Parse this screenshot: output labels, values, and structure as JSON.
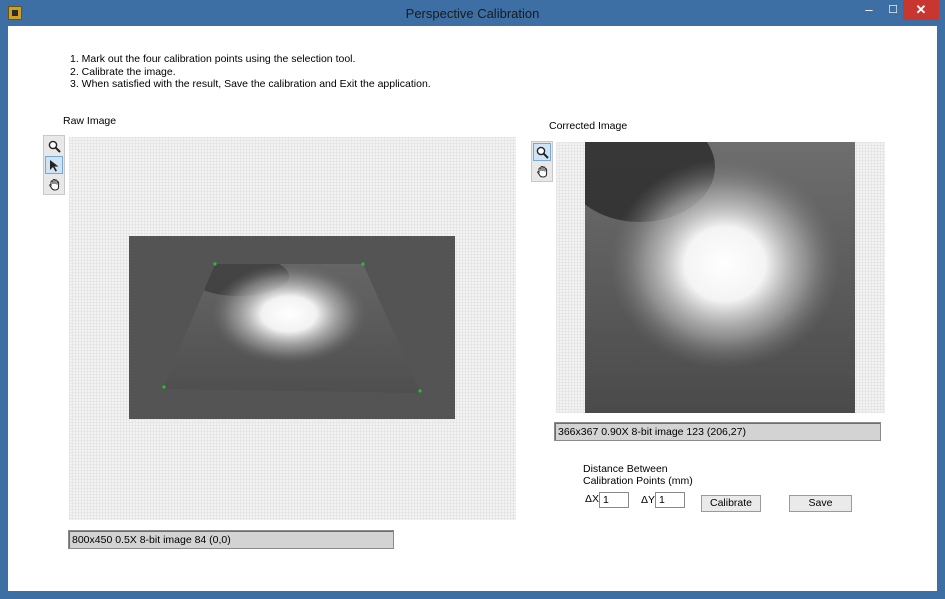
{
  "window": {
    "title": "Perspective Calibration",
    "min_glyph": "–",
    "max_glyph": "☐",
    "close_glyph": "✕"
  },
  "instructions": [
    "1. Mark out the four calibration points using the selection tool.",
    "2. Calibrate the image.",
    "3. When satisfied with the result, Save the calibration and Exit the application."
  ],
  "raw": {
    "label": "Raw Image",
    "status": "800x450 0.5X 8-bit image 84    (0,0)",
    "tools": [
      "zoom-icon",
      "pointer-icon",
      "pan-hand-icon"
    ],
    "active_tool": "pointer-icon"
  },
  "corrected": {
    "label": "Corrected Image",
    "status": "366x367 0.90X 8-bit image 123    (206,27)",
    "tools": [
      "zoom-icon",
      "pan-hand-icon"
    ],
    "active_tool": "zoom-icon"
  },
  "calibration": {
    "heading_line1": "Distance Between",
    "heading_line2": "Calibration Points (mm)",
    "dx_label": "ΔX",
    "dx_value": "1",
    "dy_label": "ΔY",
    "dy_value": "1",
    "calibrate_label": "Calibrate",
    "save_label": "Save"
  }
}
